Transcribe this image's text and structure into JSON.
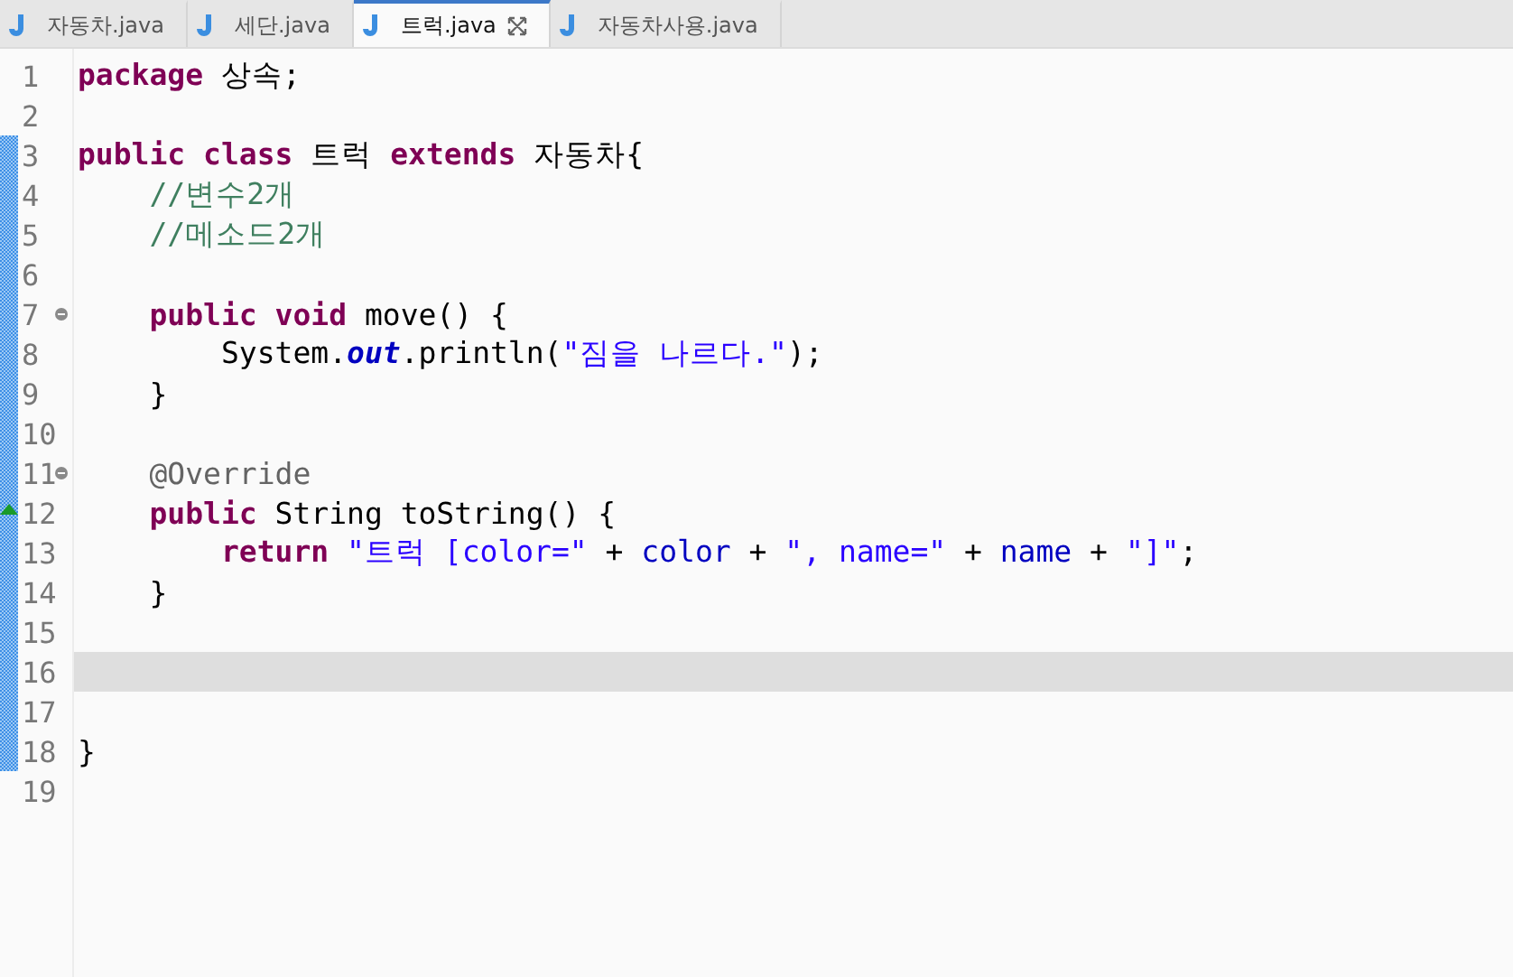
{
  "tabs": [
    {
      "label": "자동차.java",
      "selected": false,
      "closable": false
    },
    {
      "label": "세단.java",
      "selected": false,
      "closable": false
    },
    {
      "label": "트럭.java",
      "selected": true,
      "closable": true
    },
    {
      "label": "자동차사용.java",
      "selected": false,
      "closable": false
    }
  ],
  "lines": [
    {
      "number": "1",
      "changed": false,
      "current": false,
      "tokens": [
        {
          "kind": "keyword",
          "text": "package"
        },
        {
          "kind": "plain",
          "text": " 상속;"
        }
      ]
    },
    {
      "number": "2",
      "changed": false,
      "current": false
    },
    {
      "number": "3",
      "changed": true,
      "current": false,
      "tokens": [
        {
          "kind": "keyword",
          "text": "public class"
        },
        {
          "kind": "plain",
          "text": " 트럭 "
        },
        {
          "kind": "keyword",
          "text": "extends"
        },
        {
          "kind": "plain",
          "text": " 자동차{"
        }
      ]
    },
    {
      "number": "4",
      "changed": true,
      "current": false,
      "tokens": [
        {
          "kind": "comment",
          "text": "    //변수2개"
        }
      ]
    },
    {
      "number": "5",
      "changed": true,
      "current": false,
      "tokens": [
        {
          "kind": "comment",
          "text": "    //메소드2개"
        }
      ]
    },
    {
      "number": "6",
      "changed": true,
      "current": false
    },
    {
      "number": "7",
      "changed": true,
      "current": false,
      "fold": true,
      "tokens": [
        {
          "kind": "keyword",
          "text": "    public void"
        },
        {
          "kind": "plain",
          "text": " move() {"
        }
      ]
    },
    {
      "number": "8",
      "changed": true,
      "current": false,
      "tokens": [
        {
          "kind": "plain",
          "text": "        System."
        },
        {
          "kind": "field",
          "text": "out"
        },
        {
          "kind": "plain",
          "text": ".println("
        },
        {
          "kind": "string",
          "text": "\"짐을 나르다.\""
        },
        {
          "kind": "plain",
          "text": ");"
        }
      ]
    },
    {
      "number": "9",
      "changed": true,
      "current": false,
      "tokens": [
        {
          "kind": "plain",
          "text": "    }"
        }
      ]
    },
    {
      "number": "10",
      "changed": true,
      "current": false
    },
    {
      "number": "11",
      "changed": true,
      "current": false,
      "fold": true,
      "tokens": [
        {
          "kind": "annotation",
          "text": "    @Override"
        }
      ]
    },
    {
      "number": "12",
      "changed": true,
      "current": false,
      "override": true,
      "tokens": [
        {
          "kind": "keyword",
          "text": "    public"
        },
        {
          "kind": "plain",
          "text": " String toString() {"
        }
      ]
    },
    {
      "number": "13",
      "changed": true,
      "current": false,
      "tokens": [
        {
          "kind": "keyword",
          "text": "        return "
        },
        {
          "kind": "string",
          "text": "\"트럭 [color=\""
        },
        {
          "kind": "plain",
          "text": " + "
        },
        {
          "kind": "var",
          "text": "color"
        },
        {
          "kind": "plain",
          "text": " + "
        },
        {
          "kind": "string",
          "text": "\", name=\""
        },
        {
          "kind": "plain",
          "text": " + "
        },
        {
          "kind": "var",
          "text": "name"
        },
        {
          "kind": "plain",
          "text": " + "
        },
        {
          "kind": "string",
          "text": "\"]\""
        },
        {
          "kind": "plain",
          "text": ";"
        }
      ]
    },
    {
      "number": "14",
      "changed": true,
      "current": false,
      "tokens": [
        {
          "kind": "plain",
          "text": "    }"
        }
      ]
    },
    {
      "number": "15",
      "changed": true,
      "current": false
    },
    {
      "number": "16",
      "changed": true,
      "current": true
    },
    {
      "number": "17",
      "changed": true,
      "current": false
    },
    {
      "number": "18",
      "changed": true,
      "current": false,
      "tokens": [
        {
          "kind": "plain",
          "text": "}"
        }
      ]
    },
    {
      "number": "19",
      "changed": false,
      "current": false
    }
  ]
}
